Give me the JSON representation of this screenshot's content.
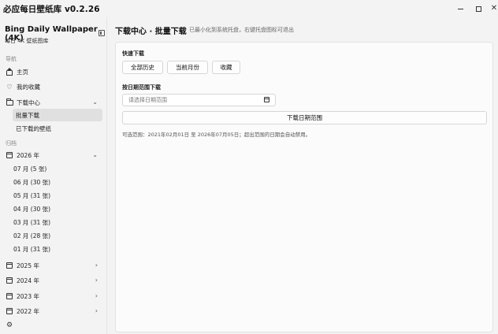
{
  "window": {
    "title": "必应每日壁纸库 v0.2.26",
    "controls": {
      "minimize": "minimize",
      "maximize": "maximize",
      "close": "✕"
    }
  },
  "sidebar": {
    "brand_title": "Bing Daily Wallpaper (4K)",
    "brand_subtitle": "每日 4K 壁纸图库",
    "nav_section": "导航",
    "nav": {
      "home": "主页",
      "favorites": "我的收藏",
      "download_center": "下载中心",
      "batch_download": "批量下载",
      "downloaded": "已下载的壁纸"
    },
    "archive_section": "归档",
    "archive": {
      "y2026": "2026 年",
      "months": [
        "07 月 (5 张)",
        "06 月 (30 张)",
        "05 月 (31 张)",
        "04 月 (30 张)",
        "03 月 (31 张)",
        "02 月 (28 张)",
        "01 月 (31 张)"
      ],
      "y2025": "2025 年",
      "y2024": "2024 年",
      "y2023": "2023 年",
      "y2022": "2022 年"
    }
  },
  "main": {
    "title": "下载中心 · 批量下载",
    "hint": "已最小化到系统托盘，右键托盘图标可退出",
    "quick_label": "快速下载",
    "quick_buttons": [
      "全部历史",
      "当前月份",
      "收藏"
    ],
    "range_label": "按日期范围下载",
    "range_placeholder": "请选择日期范围",
    "range_button": "下载日期范围",
    "note": "可选范围：2021年02月01日 至 2026年07月05日；超出范围的日期会自动禁用。"
  },
  "icons": [
    "home-icon",
    "heart-icon",
    "folder-icon",
    "calendar-icon",
    "chevron-down-icon",
    "chevron-right-icon",
    "gear-icon",
    "sidebar-toggle-icon"
  ]
}
